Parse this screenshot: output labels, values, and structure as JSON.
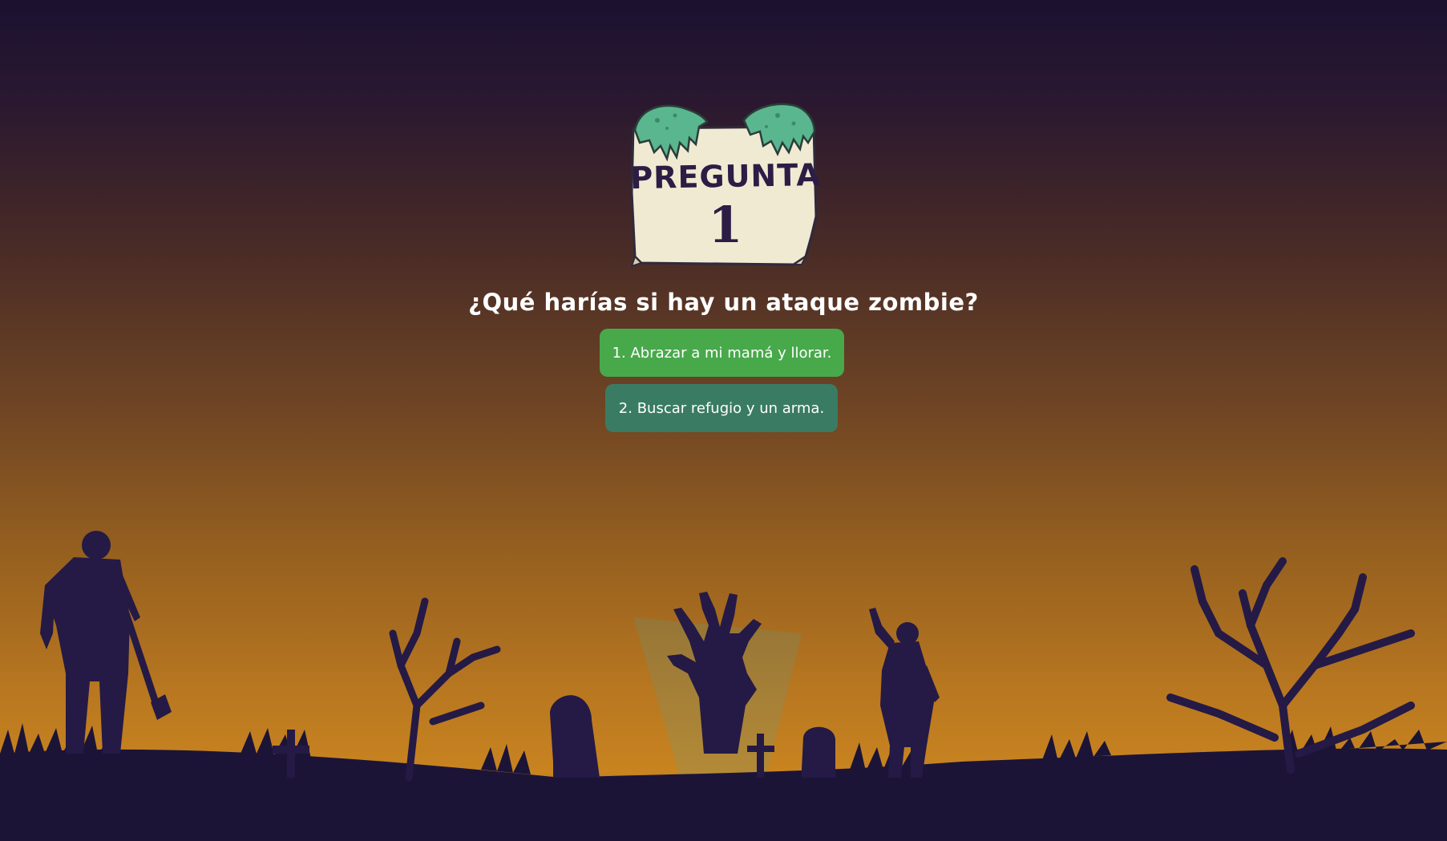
{
  "sign": {
    "title": "PREGUNTA",
    "number": "1"
  },
  "question": {
    "text": "¿Qué harías si hay un ataque zombie?"
  },
  "answers": [
    {
      "label": "1. Abrazar a mi mamá y llorar."
    },
    {
      "label": "2. Buscar refugio y un arma."
    }
  ],
  "colors": {
    "answer_primary": "#48a94b",
    "answer_secondary": "#3a7c63",
    "silhouette": "#241a45",
    "sign_paper": "#f1ead2",
    "zombie_hands": "#5ab68e"
  },
  "icons": {
    "sign_hands": "zombie-hands-icon"
  }
}
